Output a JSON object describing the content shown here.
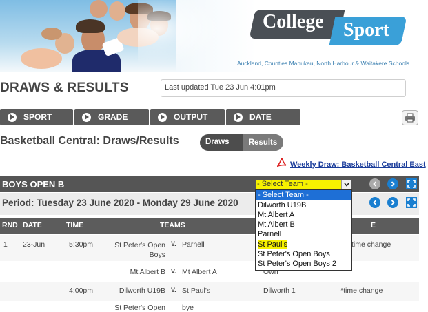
{
  "header": {
    "logo_word1": "College",
    "logo_word2": "Sport",
    "tagline": "Auckland, Counties Manukau, North Harbour & Waitakere Schools"
  },
  "page_title": "DRAWS & RESULTS",
  "last_updated": "Last updated Tue 23 Jun 4:01pm",
  "nav": [
    {
      "label": "SPORT"
    },
    {
      "label": "GRADE"
    },
    {
      "label": "OUTPUT"
    },
    {
      "label": "DATE"
    }
  ],
  "section_title": "Basketball Central: Draws/Results",
  "toggle": {
    "draws": "Draws",
    "results": "Results"
  },
  "weekly_link": "Weekly Draw: Basketball Central East",
  "team_bar": {
    "name": "BOYS OPEN B"
  },
  "period": "Period: Tuesday 23 June 2020 - Monday 29 June 2020",
  "team_select": {
    "selected": "- Select Team -",
    "options": [
      "- Select Team -",
      "Dilworth U19B",
      "Mt Albert A",
      "Mt Albert B",
      "Parnell",
      "St Paul's",
      "St Peter's Open Boys",
      "St Peter's Open Boys 2"
    ],
    "highlighted_option": "- Select Team -",
    "marked_option": "St Paul's"
  },
  "table": {
    "headers": {
      "rnd": "RND",
      "date": "DATE",
      "time": "TIME",
      "teams": "TEAMS",
      "notes": "E"
    },
    "vs_label": "V.",
    "rows": [
      {
        "rnd": "1",
        "date": "23-Jun",
        "time": "5:30pm",
        "home": "St Peter's Open Boys",
        "away": "Parnell",
        "venue": "",
        "note": "time change"
      },
      {
        "rnd": "",
        "date": "",
        "time": "",
        "home": "Mt Albert B",
        "away": "Mt Albert A",
        "venue": "Own",
        "note": ""
      },
      {
        "rnd": "",
        "date": "",
        "time": "4:00pm",
        "home": "Dilworth U19B",
        "away": "St Paul's",
        "venue": "Dilworth 1",
        "note": "*time change"
      },
      {
        "rnd": "",
        "date": "",
        "time": "",
        "home": "St Peter's Open",
        "away": "bye",
        "venue": "",
        "note": ""
      }
    ]
  },
  "colors": {
    "accent_blue": "#3aa0d8",
    "dark_bar": "#555555",
    "select_highlight": "#f7f200",
    "option_highlight": "#1e6fd6"
  }
}
